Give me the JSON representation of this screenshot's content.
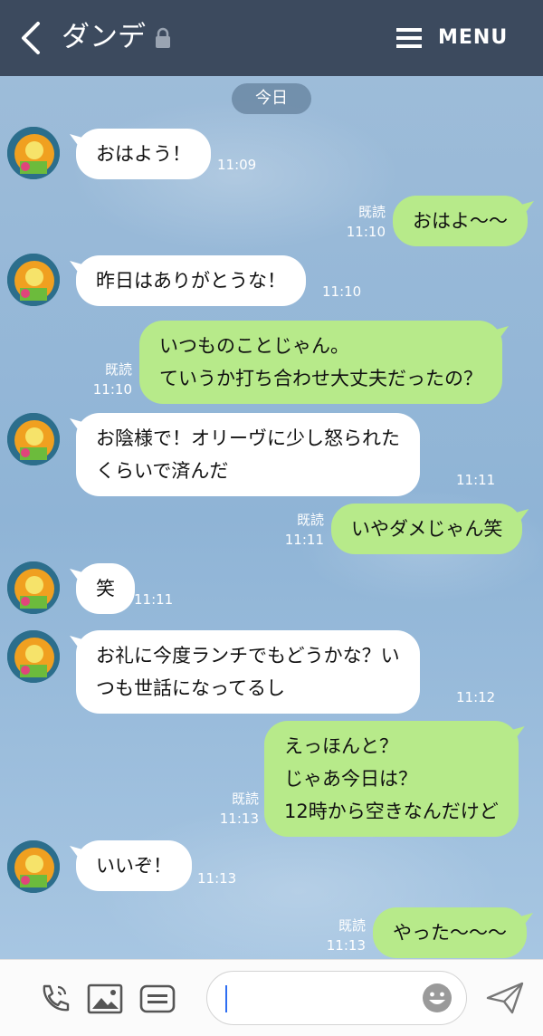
{
  "header": {
    "title": "ダンデ",
    "menu_label": "MENU"
  },
  "chat": {
    "date_label": "今日",
    "messages": [
      {
        "side": "in",
        "lines": [
          "おはよう！"
        ],
        "time": "11:09"
      },
      {
        "side": "out",
        "lines": [
          "おはよ〜〜"
        ],
        "read": "既読",
        "time": "11:10"
      },
      {
        "side": "in",
        "lines": [
          "昨日はありがとうな！"
        ],
        "time": "11:10"
      },
      {
        "side": "out",
        "lines": [
          "いつものことじゃん。",
          "ていうか打ち合わせ大丈夫だったの？"
        ],
        "read": "既読",
        "time": "11:10"
      },
      {
        "side": "in",
        "lines": [
          "お陰様で！オリーヴに少し怒られた",
          "くらいで済んだ"
        ],
        "time": "11:11"
      },
      {
        "side": "out",
        "lines": [
          "いやダメじゃん笑"
        ],
        "read": "既読",
        "time": "11:11"
      },
      {
        "side": "in",
        "lines": [
          "笑"
        ],
        "time": "11:11"
      },
      {
        "side": "in",
        "lines": [
          "お礼に今度ランチでもどうかな？い",
          "つも世話になってるし"
        ],
        "time": "11:12"
      },
      {
        "side": "out",
        "lines": [
          "えっほんと？",
          "じゃあ今日は？",
          "12時から空きなんだけど"
        ],
        "read": "既読",
        "time": "11:13"
      },
      {
        "side": "in",
        "lines": [
          "いいぞ！"
        ],
        "time": "11:13"
      },
      {
        "side": "out",
        "lines": [
          "やった〜〜〜"
        ],
        "read": "既読",
        "time": "11:13"
      }
    ]
  },
  "input_bar": {
    "icons": [
      "phone-icon",
      "image-icon",
      "sticker-icon",
      "emoji-icon",
      "send-icon"
    ],
    "text_value": ""
  },
  "colors": {
    "header_bg": "#3c4a5e",
    "incoming_bubble": "#ffffff",
    "outgoing_bubble": "#b7ea8a",
    "chat_bg": "#8fb3d3"
  }
}
